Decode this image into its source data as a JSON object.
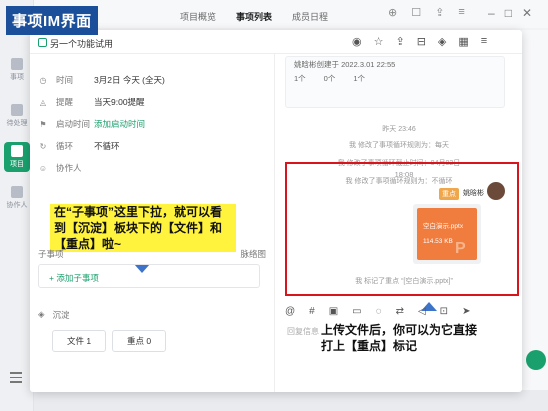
{
  "title_badge": "事项IM界面",
  "top_tabs": [
    "项目概览",
    "事项列表",
    "成员日程"
  ],
  "top_icons": [
    "plus-icon",
    "chat-icon",
    "share-icon",
    "menu-icon"
  ],
  "window_controls": [
    "minimize",
    "maximize",
    "close"
  ],
  "rail": [
    {
      "label": "事项"
    },
    {
      "label": "待处理"
    },
    {
      "label": "项目",
      "active": true
    },
    {
      "label": "协作人"
    }
  ],
  "dialog": {
    "checkbox_label": "另一个功能试用",
    "header_icons": [
      "eye-icon",
      "star-icon",
      "share-icon",
      "filter-icon",
      "layers-icon",
      "grid-icon",
      "more-icon"
    ],
    "fields": [
      {
        "icon": "clock-icon",
        "label": "时间",
        "value": "3月2日 今天 (全天)"
      },
      {
        "icon": "bell-icon",
        "label": "提醒",
        "value": "当天9:00提醒"
      },
      {
        "icon": "flag-icon",
        "label": "启动时间",
        "value": "添加启动时间",
        "link": true
      },
      {
        "icon": "repeat-icon",
        "label": "循环",
        "value": "不循环"
      },
      {
        "icon": "user-icon",
        "label": "协作人",
        "value": ""
      }
    ],
    "annotation_left": "在“子事项”这里下拉，就可以看到【沉淀】板块下的【文件】和【重点】啦~",
    "subitems_label": "子事项",
    "subitems_right": "脉络图",
    "add_subitem": "+ 添加子事项",
    "settle_label": "沉淀",
    "buttons": [
      "文件 1",
      "重点 0"
    ],
    "card": {
      "created_by": "姚晗彬创建于 2022.3.01 22:55",
      "stats": [
        "1个",
        "0个",
        "1个"
      ]
    },
    "system_messages": [
      "昨天 23:46",
      "我 修改了事项循环规则为：每天",
      "我 修改了事项循环截止时间：04月02日",
      "我 修改了事项循环规则为：不循环"
    ],
    "message": {
      "time": "18:08",
      "tag": "重点",
      "sender": "姚晗彬",
      "file_name": "空白演示.pptx",
      "file_size": "114.53 KB",
      "file_mark": "P",
      "note": "我 标记了重点 “[空白演示.pptx]”"
    },
    "toolbar": [
      "@",
      "#",
      "image-icon",
      "folder-icon",
      "comment-icon",
      "share-icon",
      "volume-icon",
      "gift-icon",
      "send-icon"
    ],
    "reply_placeholder": "回复信息",
    "annotation_right": "上传文件后，你可以为它直接打上【重点】标记"
  }
}
